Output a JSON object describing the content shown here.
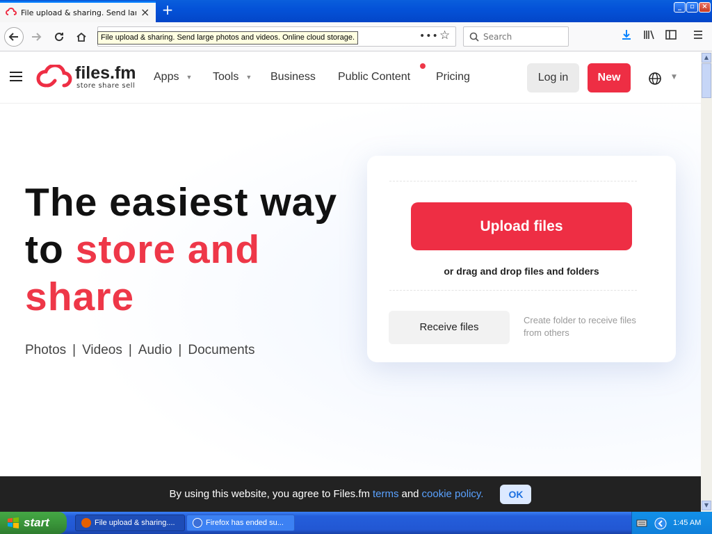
{
  "browser": {
    "tab_title": "File upload & sharing. Send large photos and videos. Online cloud storage.",
    "tooltip": "File upload & sharing. Send large photos and videos. Online cloud storage.",
    "search_placeholder": "Search",
    "url_actions": "•••"
  },
  "site": {
    "logo_name": "files.fm",
    "logo_tagline": "store  share  sell",
    "nav": {
      "apps": "Apps",
      "tools": "Tools",
      "business": "Business",
      "public_content": "Public Content",
      "pricing": "Pricing"
    },
    "login": "Log in",
    "new": "New"
  },
  "hero": {
    "line1": "The easiest way",
    "line2_plain": "to ",
    "line2_accent": "store and",
    "line3_accent": "share",
    "media": [
      "Photos",
      "Videos",
      "Audio",
      "Documents"
    ],
    "media_separator": "|"
  },
  "upload": {
    "button": "Upload files",
    "hint": "or drag and drop files and folders",
    "receive_button": "Receive files",
    "receive_hint": "Create folder to receive files from others"
  },
  "cookie": {
    "text_before": "By using this website, you agree to Files.fm",
    "terms": "terms",
    "and": "and",
    "policy": "cookie policy.",
    "ok": "OK"
  },
  "taskbar": {
    "start": "start",
    "task1": "File upload & sharing....",
    "task2": "Firefox has ended su...",
    "clock": "1:45 AM"
  },
  "colors": {
    "brand_red": "#ee2e44",
    "accent_text": "#ee3748",
    "link_blue": "#5aa2ff"
  }
}
